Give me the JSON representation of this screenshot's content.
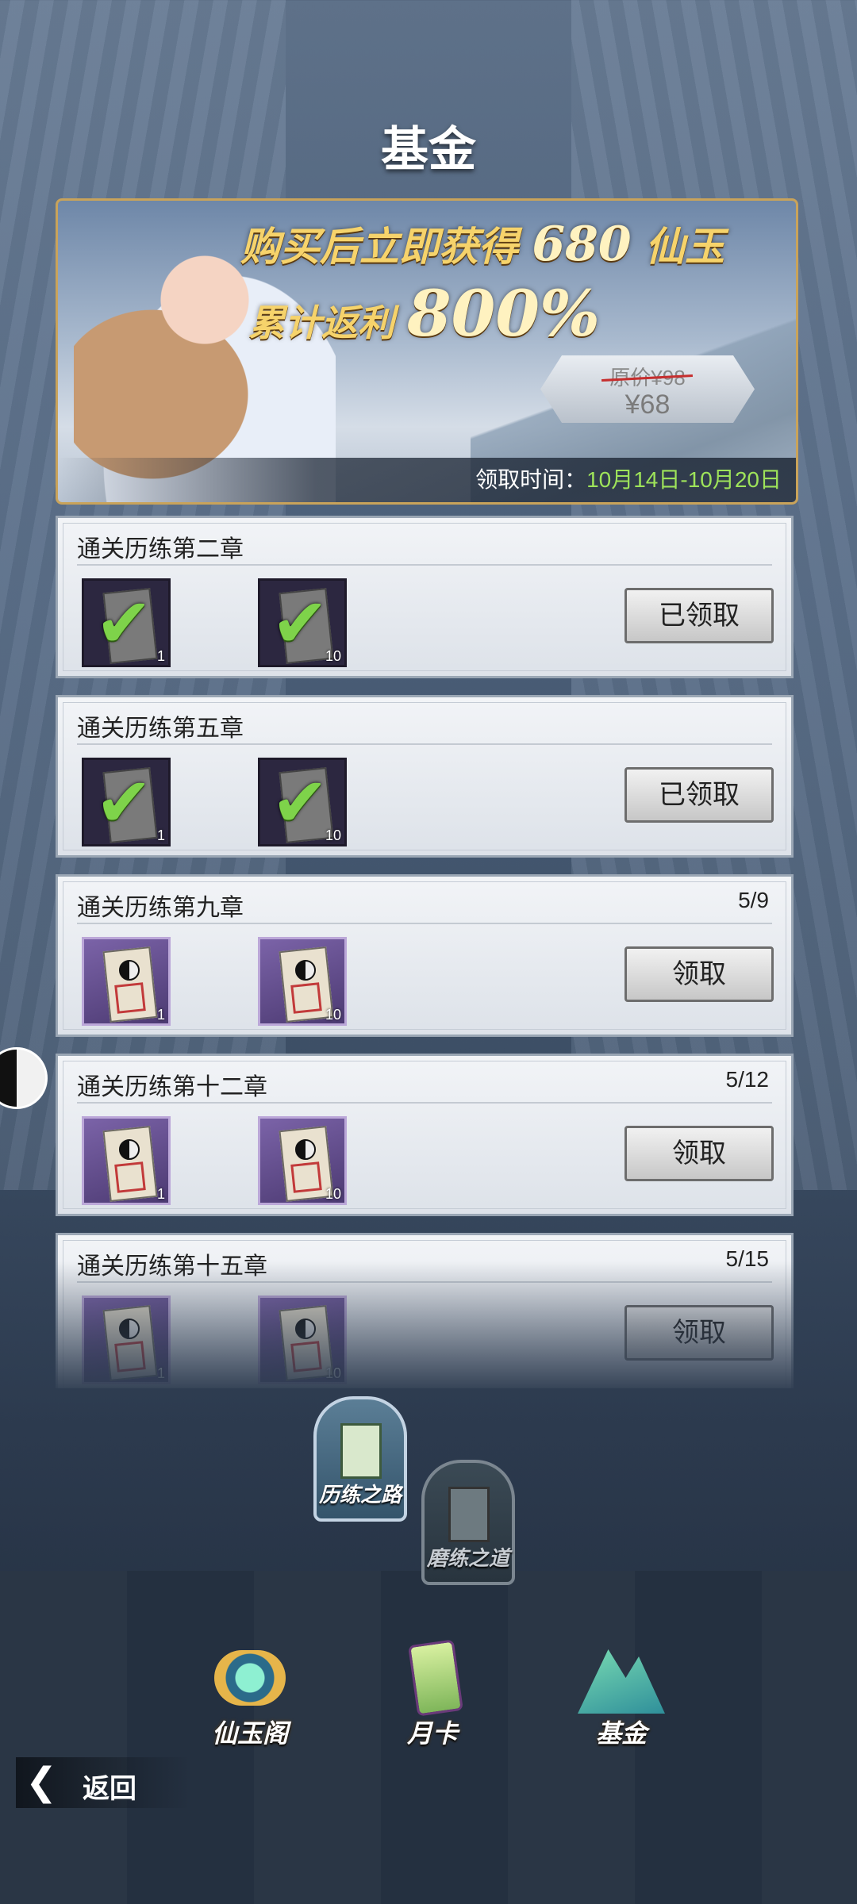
{
  "page": {
    "title": "基金"
  },
  "banner": {
    "line1_prefix": "购买后立即获得",
    "line1_amount": "680",
    "line1_suffix": "仙玉",
    "line2_prefix": "累计返利",
    "line2_percent": "800%",
    "price_original": "原价¥98",
    "price_now": "¥68",
    "claim_label": "领取时间：",
    "claim_dates": "10月14日-10月20日"
  },
  "rewards": [
    {
      "title": "通关历练第二章",
      "progress": "",
      "items": [
        {
          "count": "1"
        },
        {
          "count": "10"
        }
      ],
      "button": "已领取",
      "claimed": true
    },
    {
      "title": "通关历练第五章",
      "progress": "",
      "items": [
        {
          "count": "1"
        },
        {
          "count": "10"
        }
      ],
      "button": "已领取",
      "claimed": true
    },
    {
      "title": "通关历练第九章",
      "progress": "5/9",
      "items": [
        {
          "count": "1"
        },
        {
          "count": "10"
        }
      ],
      "button": "领取",
      "claimed": false
    },
    {
      "title": "通关历练第十二章",
      "progress": "5/12",
      "items": [
        {
          "count": "1"
        },
        {
          "count": "10"
        }
      ],
      "button": "领取",
      "claimed": false
    },
    {
      "title": "通关历练第十五章",
      "progress": "5/15",
      "items": [
        {
          "count": "1"
        },
        {
          "count": "10"
        }
      ],
      "button": "领取",
      "claimed": false
    }
  ],
  "subtabs": {
    "active": "历练之路",
    "inactive": "磨练之道"
  },
  "nav": {
    "xianyu": "仙玉阁",
    "month": "月卡",
    "fund": "基金"
  },
  "back": {
    "label": "返回"
  },
  "colors": {
    "accent_gold": "#f6d36b",
    "claim_green": "#9ee35a",
    "check_green": "#7ed34a"
  }
}
